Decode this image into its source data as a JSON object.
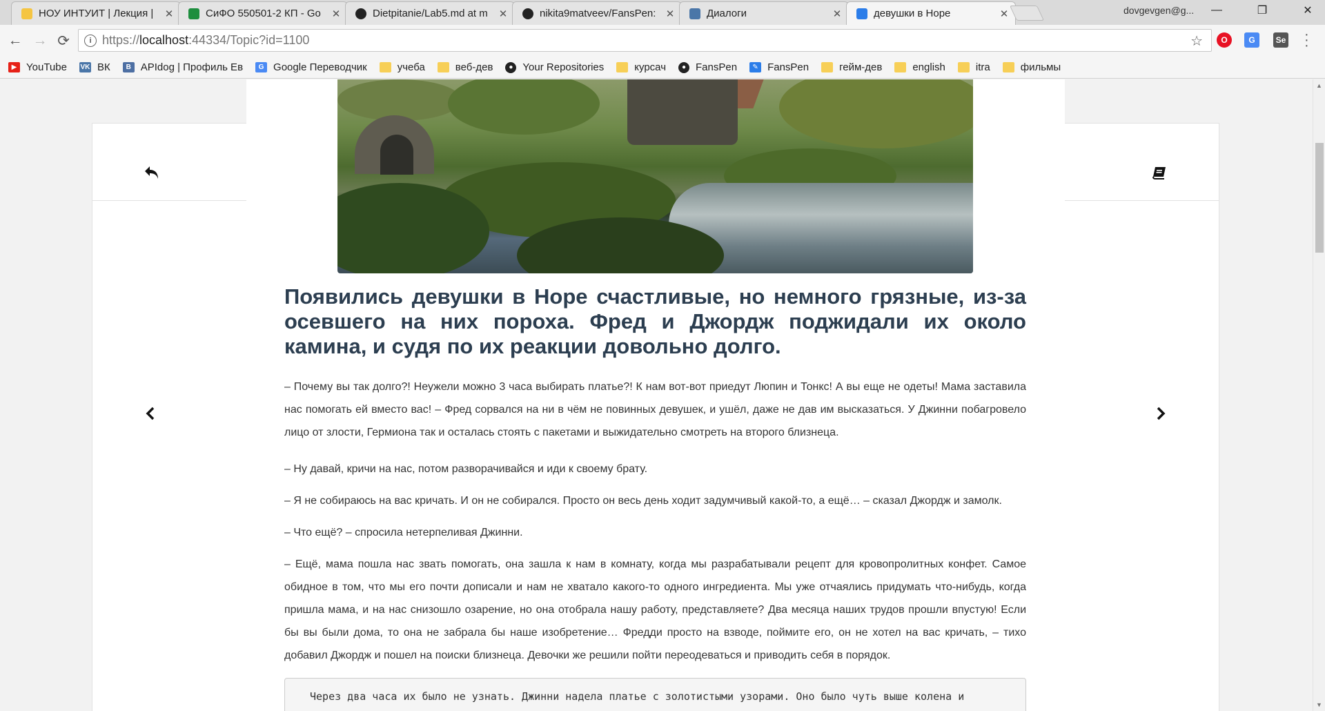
{
  "browser": {
    "tabs": [
      {
        "title": "НОУ ИНТУИТ | Лекция |",
        "icon": "intuit-icon",
        "color": "#f5c542",
        "active": false
      },
      {
        "title": "СиФО 550501-2 КП - Go",
        "icon": "sheets-icon",
        "color": "#1e8e3e",
        "active": false
      },
      {
        "title": "Dietpitanie/Lab5.md at m",
        "icon": "github-icon",
        "color": "#222222",
        "active": false
      },
      {
        "title": "nikita9matveev/FansPen:",
        "icon": "github-icon",
        "color": "#222222",
        "active": false
      },
      {
        "title": "Диалоги",
        "icon": "dialogs-icon",
        "color": "#4a76a8",
        "active": false
      },
      {
        "title": "девушки в Норе",
        "icon": "fanspen-icon",
        "color": "#2b7de9",
        "active": true
      }
    ],
    "close_glyph": "✕",
    "profile": "dovgevgen@g...",
    "window": {
      "minimize": "—",
      "restore": "❐",
      "close": "✕"
    },
    "nav": {
      "back": "←",
      "forward": "→",
      "reload": "⟳"
    },
    "address": {
      "scheme": "https://",
      "host": "localhost",
      "rest": ":44334/Topic?id=1100",
      "info": "i"
    },
    "star": "☆",
    "extensions": [
      {
        "name": "opera-icon",
        "label": "O",
        "color": "#e81123"
      },
      {
        "name": "translate-icon",
        "label": "G",
        "color": "#4a8af4"
      },
      {
        "name": "selenium-icon",
        "label": "Se",
        "color": "#555555"
      }
    ],
    "bookmarks": [
      {
        "label": "YouTube",
        "icon": "youtube-icon",
        "color": "#e62117",
        "glyph": "▶"
      },
      {
        "label": "ВК",
        "icon": "vk-icon",
        "color": "#4a76a8",
        "glyph": "VK"
      },
      {
        "label": "APIdog | Профиль Ев",
        "icon": "apidog-icon",
        "color": "#4d6fa3",
        "glyph": "B"
      },
      {
        "label": "Google Переводчик",
        "icon": "google-translate-icon",
        "color": "#4a8af4",
        "glyph": "G"
      },
      {
        "label": "учеба",
        "icon": "folder-icon",
        "color": "#f7cf57",
        "glyph": ""
      },
      {
        "label": "веб-дев",
        "icon": "folder-icon",
        "color": "#f7cf57",
        "glyph": ""
      },
      {
        "label": "Your Repositories",
        "icon": "github-icon",
        "color": "#222222",
        "glyph": "●"
      },
      {
        "label": "курсач",
        "icon": "folder-icon",
        "color": "#f7cf57",
        "glyph": ""
      },
      {
        "label": "FansPen",
        "icon": "github-icon",
        "color": "#222222",
        "glyph": "●"
      },
      {
        "label": "FansPen",
        "icon": "fanspen-icon",
        "color": "#2b7de9",
        "glyph": "✎"
      },
      {
        "label": "гейм-дев",
        "icon": "folder-icon",
        "color": "#f7cf57",
        "glyph": ""
      },
      {
        "label": "english",
        "icon": "folder-icon",
        "color": "#f7cf57",
        "glyph": ""
      },
      {
        "label": "itra",
        "icon": "folder-icon",
        "color": "#f7cf57",
        "glyph": ""
      },
      {
        "label": "фильмы",
        "icon": "folder-icon",
        "color": "#f7cf57",
        "glyph": ""
      }
    ]
  },
  "reader": {
    "heading": "Появились девушки в Норе счастливые, но немного грязные, из-за осевшего на них пороха. Фред и Джордж поджидали их около камина, и судя по их реакции довольно долго.",
    "paragraphs": [
      "– Почему вы так долго?! Неужели можно 3 часа выбирать платье?! К нам вот-вот приедут Люпин и Тонкс! А вы еще не одеты! Мама заставила нас помогать ей вместо вас! – Фред сорвался на ни в чём не повинных девушек, и ушёл, даже не дав им высказаться. У Джинни побагровело лицо от злости, Гермиона так и осталась стоять с пакетами и выжидательно смотреть на второго близнеца.",
      "– Ну давай, кричи на нас, потом разворачивайся и иди к своему брату.",
      "– Я не собираюсь на вас кричать. И он не собирался. Просто он весь день ходит задумчивый какой-то, а ещё… – сказал Джордж и замолк.",
      "– Что ещё? – спросила нетерпеливая Джинни.",
      "– Ещё, мама пошла нас звать помогать, она зашла к нам в комнату, когда мы разрабатывали рецепт для кровопролитных конфет. Самое обидное в том, что мы его почти дописали и нам не хватало какого-то одного ингредиента. Мы уже отчаялись придумать что-нибудь, когда пришла мама, и на нас снизошло озарение, но она отобрала нашу работу, представляете? Два месяца наших трудов прошли впустую! Если бы вы были дома, то она не забрала бы наше изобретение… Фредди просто на взводе, поймите его, он не хотел на вас кричать, – тихо добавил Джордж и пошел на поиски близнеца. Девочки же решили пойти переодеваться и приводить себя в порядок."
    ],
    "code_text": "Через два часа их было не узнать. Джинни надела платье с золотистыми узорами. Оно было чуть выше колена и",
    "icons": {
      "back": "reply-icon",
      "book": "book-icon",
      "prev": "chevron-left-icon",
      "next": "chevron-right-icon"
    },
    "colors": {
      "heading": "#2c3e50",
      "text": "#333333",
      "accent": "#2b7de9"
    }
  }
}
